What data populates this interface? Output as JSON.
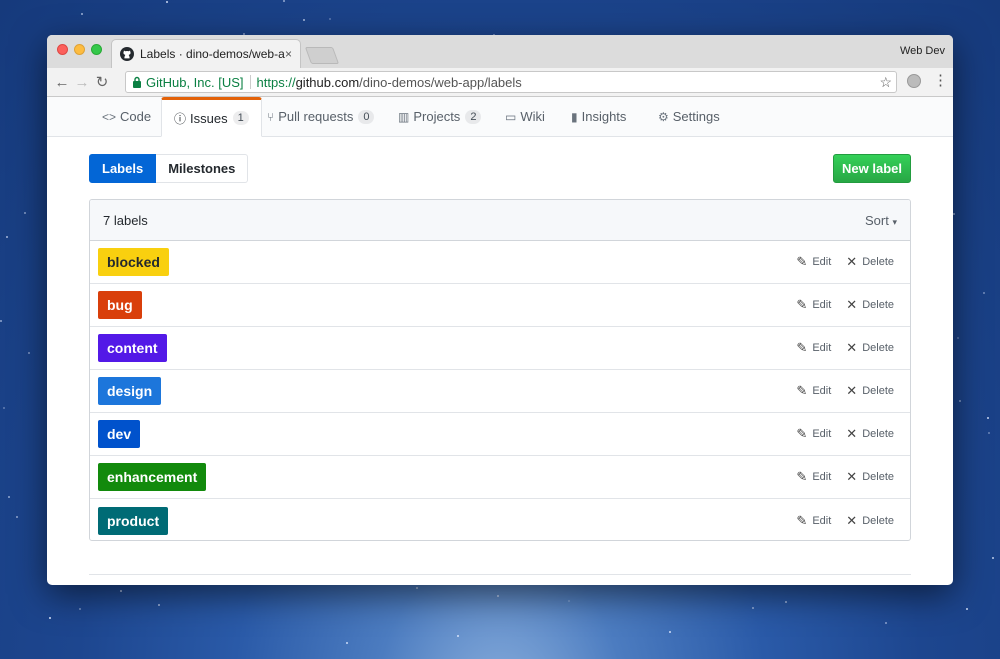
{
  "browser": {
    "tab_title": "Labels · dino-demos/web-app",
    "tab_close": "×",
    "profile": "Web Dev",
    "secure_label": "GitHub, Inc. [US]",
    "url_scheme": "https://",
    "url_host": "github.com",
    "url_path": "/dino-demos/web-app/labels"
  },
  "repo_nav": {
    "code": "Code",
    "issues": "Issues",
    "issues_count": "1",
    "pull_requests": "Pull requests",
    "pull_requests_count": "0",
    "projects": "Projects",
    "projects_count": "2",
    "wiki": "Wiki",
    "insights": "Insights",
    "settings": "Settings"
  },
  "subnav": {
    "labels": "Labels",
    "milestones": "Milestones"
  },
  "new_label_button": "New label",
  "labels_header": {
    "count_text": "7 labels",
    "sort": "Sort"
  },
  "actions": {
    "edit": "Edit",
    "delete": "Delete"
  },
  "labels": [
    {
      "name": "blocked",
      "color": "#f9d00f",
      "text_color": "#24292e"
    },
    {
      "name": "bug",
      "color": "#d93f0b",
      "text_color": "#ffffff"
    },
    {
      "name": "content",
      "color": "#5319e7",
      "text_color": "#ffffff"
    },
    {
      "name": "design",
      "color": "#1d76db",
      "text_color": "#ffffff"
    },
    {
      "name": "dev",
      "color": "#0052cc",
      "text_color": "#ffffff"
    },
    {
      "name": "enhancement",
      "color": "#128a0c",
      "text_color": "#ffffff"
    },
    {
      "name": "product",
      "color": "#006b75",
      "text_color": "#ffffff"
    }
  ],
  "colors": {
    "accent": "#0366d6",
    "new_label_green": "#28a745",
    "selected_tab_bar": "#e36209"
  }
}
